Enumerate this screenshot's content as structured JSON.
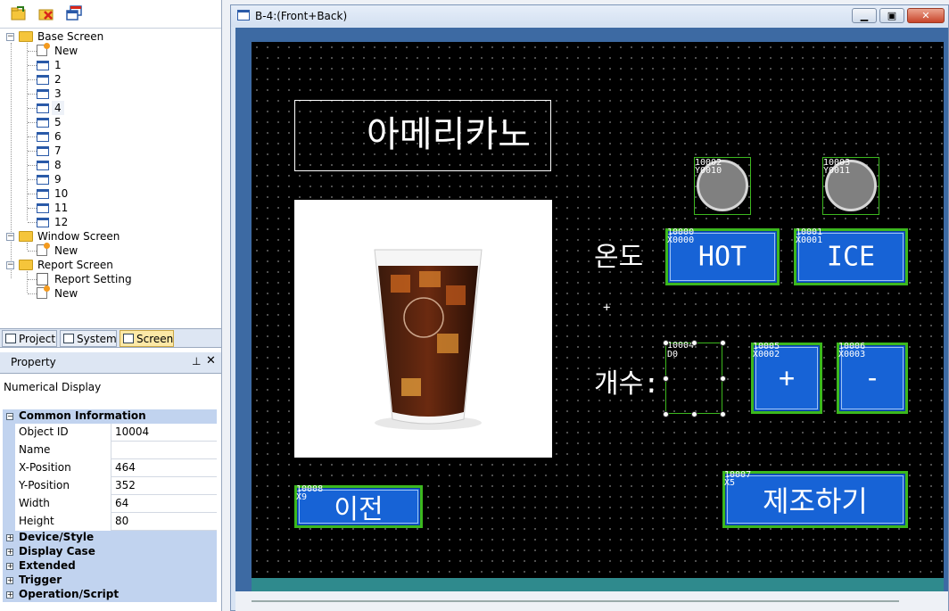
{
  "toolbar": {
    "icons": [
      "open-folder-icon",
      "delete-icon",
      "copy-window-icon"
    ]
  },
  "tree": {
    "base_screen": "Base Screen",
    "base_items": [
      "New",
      "1",
      "2",
      "3",
      "4",
      "5",
      "6",
      "7",
      "8",
      "9",
      "10",
      "11",
      "12"
    ],
    "window_screen": "Window Screen",
    "window_items": [
      "New"
    ],
    "report_screen": "Report Screen",
    "report_items": [
      "Report Setting",
      "New"
    ]
  },
  "tabs": [
    {
      "label": "Project"
    },
    {
      "label": "System"
    },
    {
      "label": "Screen",
      "active": true
    }
  ],
  "property": {
    "title": "Property",
    "pin": "ꟷ",
    "close": "✕",
    "object_type": "Numerical Display",
    "common_info": "Common Information",
    "rows": [
      {
        "key": "Object ID",
        "value": "10004"
      },
      {
        "key": "Name",
        "value": ""
      },
      {
        "key": "X-Position",
        "value": "464"
      },
      {
        "key": "Y-Position",
        "value": "352"
      },
      {
        "key": "Width",
        "value": "64"
      },
      {
        "key": "Height",
        "value": "80"
      }
    ],
    "collapsed": [
      "Device/Style",
      "Display Case",
      "Extended",
      "Trigger",
      "Operation/Script"
    ]
  },
  "window": {
    "title": "B-4:(Front+Back)",
    "min": "▭",
    "restore": "▣",
    "close": "✕"
  },
  "screen": {
    "title_text": "아메리카노",
    "temp_label": "온도",
    "count_label": "개수:",
    "lamp1": {
      "id": "10002",
      "addr": "Y0010"
    },
    "lamp2": {
      "id": "10003",
      "addr": "Y0011"
    },
    "hot": {
      "id": "10000",
      "addr": "X0000",
      "label": "HOT"
    },
    "ice": {
      "id": "10001",
      "addr": "X0001",
      "label": "ICE"
    },
    "numdisp": {
      "id": "10004",
      "addr": "D0"
    },
    "plus": {
      "id": "10005",
      "addr": "X0002",
      "label": "+"
    },
    "minus": {
      "id": "10006",
      "addr": "X0003",
      "label": "-"
    },
    "prev": {
      "id": "10008",
      "addr": "X9",
      "label": "이전"
    },
    "make": {
      "id": "10007",
      "addr": "X5",
      "label": "제조하기"
    },
    "crosshair": "+"
  }
}
